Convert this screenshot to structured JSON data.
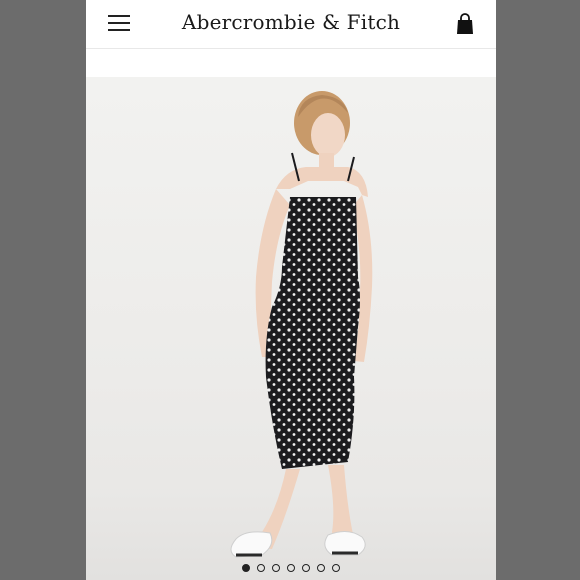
{
  "header": {
    "brand": "Abercrombie & Fitch",
    "menu_icon": "hamburger-menu-icon",
    "bag_icon": "shopping-bag-icon"
  },
  "carousel": {
    "slides": 7,
    "active_index": 0
  },
  "colors": {
    "background": "#707070",
    "screen": "#ffffff",
    "brand_text": "#1a1a1a",
    "dress": "#1b1b1e"
  }
}
